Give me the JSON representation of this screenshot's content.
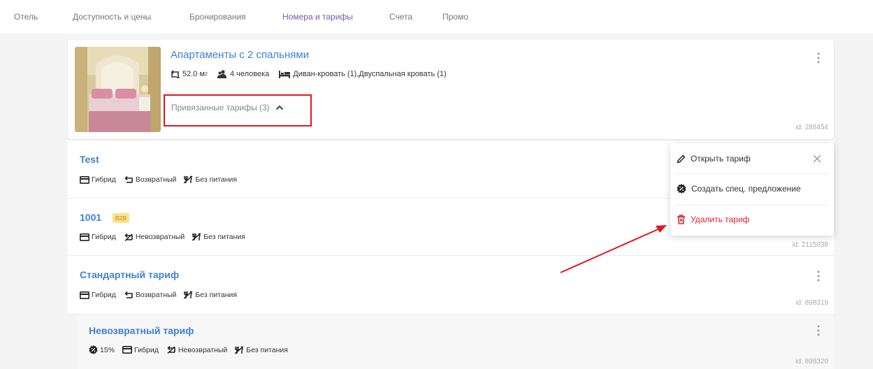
{
  "nav": {
    "items": [
      "Отель",
      "Доступность и цены",
      "Бронирования",
      "Номера и тарифы",
      "Счета",
      "Промо"
    ],
    "active": "Номера и тарифы"
  },
  "room": {
    "title": "Апартаменты с 2 спальнями",
    "area": "52.0 м",
    "area_unit_sup": "2",
    "guests": "4 человека",
    "beds": "Диван-кровать (1),Двуспальная кровать (1)",
    "linked_tariffs_label": "Привязанные тарифы (3)",
    "id": "id: 288454"
  },
  "tariffs": [
    {
      "name": "Test",
      "tags": [
        "Гибрид",
        "Возвратный",
        "Без питания"
      ],
      "id": ""
    },
    {
      "name": "1001",
      "badge": "B2B",
      "tags": [
        "Гибрид",
        "Невозвратный",
        "Без питания"
      ],
      "id": "id: 2115038"
    },
    {
      "name": "Стандартный тариф",
      "tags": [
        "Гибрид",
        "Возвратный",
        "Без питания"
      ],
      "id": "id: 898319"
    }
  ],
  "subtariff": {
    "name": "Невозвратный тариф",
    "discount": "15%",
    "tags": [
      "Гибрид",
      "Невозвратный",
      "Без питания"
    ],
    "id": "id: 898320"
  },
  "menu": {
    "open": "Открыть тариф",
    "special_offer": "Создать спец. предложение",
    "delete": "Удалить тариф"
  },
  "colors": {
    "accent_link": "#3d82d1",
    "nav_active": "#7a5aa6",
    "danger": "#d6262e",
    "highlight_box": "#e4161b",
    "b2b_badge": "#fce28a"
  }
}
